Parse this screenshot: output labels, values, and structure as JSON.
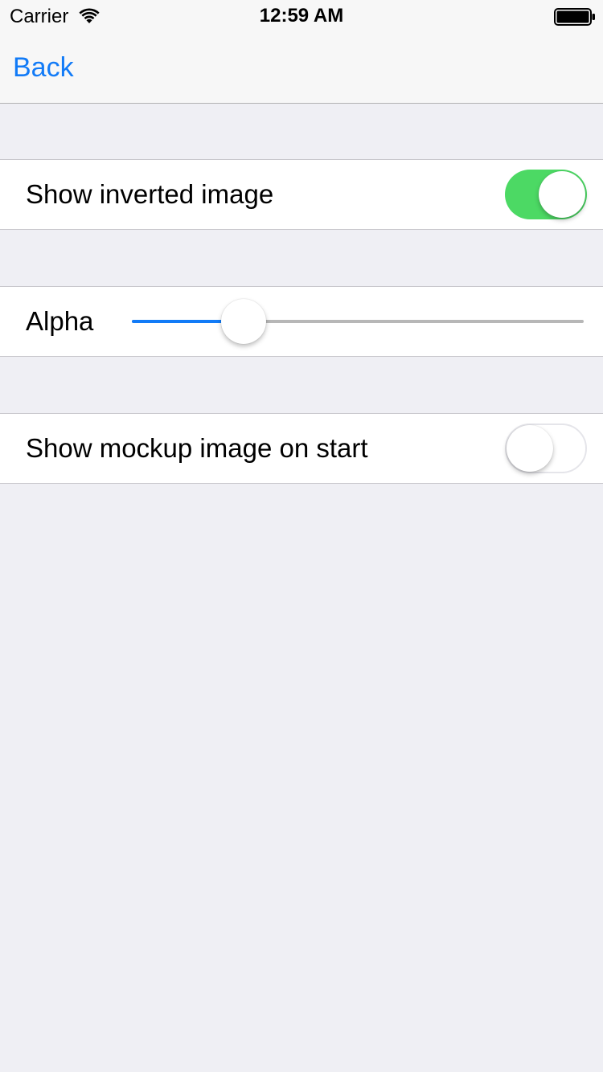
{
  "status_bar": {
    "carrier": "Carrier",
    "time": "12:59 AM",
    "wifi_icon": "wifi-icon",
    "battery_icon": "battery-icon"
  },
  "nav_bar": {
    "back_label": "Back"
  },
  "settings": {
    "show_inverted_image": {
      "label": "Show inverted image",
      "on": true
    },
    "alpha": {
      "label": "Alpha",
      "value": 0.22
    },
    "show_mockup_on_start": {
      "label": "Show mockup image on start",
      "on": false
    }
  },
  "colors": {
    "tint": "#127bf7",
    "switch_on": "#4cd964",
    "background": "#efeff4"
  }
}
